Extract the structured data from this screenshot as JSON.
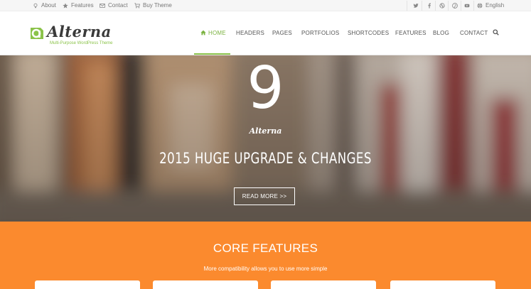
{
  "topbar": {
    "links": [
      {
        "label": "About",
        "icon": "lightbulb-icon"
      },
      {
        "label": "Features",
        "icon": "star-icon"
      },
      {
        "label": "Contact",
        "icon": "envelope-icon"
      },
      {
        "label": "Buy Theme",
        "icon": "cart-icon"
      }
    ],
    "social": [
      "twitter-icon",
      "facebook-icon",
      "dribbble-icon",
      "pinterest-icon",
      "youtube-icon"
    ],
    "language": {
      "label": "English",
      "icon": "globe-icon"
    }
  },
  "header": {
    "logo_word": "Alterna",
    "logo_tagline": "Multi-Purpose WordPress Theme",
    "brand_color": "#8bc34a",
    "nav": [
      {
        "label": "Home",
        "active": true,
        "icon": "home-icon"
      },
      {
        "label": "Headers"
      },
      {
        "label": "Pages"
      },
      {
        "label": "Portfolios"
      },
      {
        "label": "Shortcodes"
      },
      {
        "label": "Features"
      },
      {
        "label": "Blog"
      },
      {
        "label": "Contact"
      }
    ]
  },
  "hero": {
    "number": "9",
    "brand": "Alterna",
    "title": "2015 HUGE UPGRADE & CHANGES",
    "button": "READ MORE >>"
  },
  "features": {
    "title": "CORE FEATURES",
    "subtitle": "More compatibility allows you to use more simple",
    "background": "#fb8a2e"
  }
}
